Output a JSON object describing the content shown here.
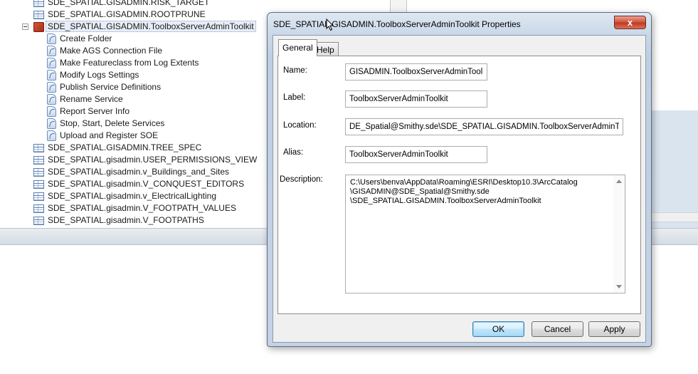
{
  "tree": {
    "items": [
      {
        "label": "SDE_SPATIAL.GISADMIN.RISK_TARGET",
        "icon": "table-icon",
        "indent": 0
      },
      {
        "label": "SDE_SPATIAL.GISADMIN.ROOTPRUNE",
        "icon": "table-icon",
        "indent": 0
      },
      {
        "label": "SDE_SPATIAL.GISADMIN.ToolboxServerAdminToolkit",
        "icon": "toolbox-icon",
        "indent": 0,
        "expanded": true,
        "selected": true
      },
      {
        "label": "Create Folder",
        "icon": "script-tool-icon",
        "indent": 1
      },
      {
        "label": "Make AGS Connection File",
        "icon": "script-tool-icon",
        "indent": 1
      },
      {
        "label": "Make Featureclass from Log Extents",
        "icon": "script-tool-icon",
        "indent": 1
      },
      {
        "label": "Modify Logs Settings",
        "icon": "script-tool-icon",
        "indent": 1
      },
      {
        "label": "Publish Service Definitions",
        "icon": "script-tool-icon",
        "indent": 1
      },
      {
        "label": "Rename Service",
        "icon": "script-tool-icon",
        "indent": 1
      },
      {
        "label": "Report Server Info",
        "icon": "script-tool-icon",
        "indent": 1
      },
      {
        "label": "Stop, Start, Delete Services",
        "icon": "script-tool-icon",
        "indent": 1
      },
      {
        "label": "Upload and Register SOE",
        "icon": "script-tool-icon",
        "indent": 1
      },
      {
        "label": "SDE_SPATIAL.GISADMIN.TREE_SPEC",
        "icon": "table-icon",
        "indent": 0
      },
      {
        "label": "SDE_SPATIAL.gisadmin.USER_PERMISSIONS_VIEW",
        "icon": "table-icon",
        "indent": 0
      },
      {
        "label": "SDE_SPATIAL.gisadmin.v_Buildings_and_Sites",
        "icon": "table-icon",
        "indent": 0
      },
      {
        "label": "SDE_SPATIAL.gisadmin.V_CONQUEST_EDITORS",
        "icon": "table-icon",
        "indent": 0
      },
      {
        "label": "SDE_SPATIAL.gisadmin.v_ElectricalLighting",
        "icon": "table-icon",
        "indent": 0
      },
      {
        "label": "SDE_SPATIAL.gisadmin.V_FOOTPATH_VALUES",
        "icon": "table-icon",
        "indent": 0
      },
      {
        "label": "SDE_SPATIAL.gisadmin.V_FOOTPATHS",
        "icon": "table-icon",
        "indent": 0
      }
    ]
  },
  "dialog": {
    "title": "SDE_SPATIAL.GISADMIN.ToolboxServerAdminToolkit Properties",
    "close_label": "x",
    "tabs": {
      "general": "General",
      "help": "Help"
    },
    "fields": {
      "name_label": "Name:",
      "name_value": "GISADMIN.ToolboxServerAdminToolkit",
      "label_label": "Label:",
      "label_value": "ToolboxServerAdminToolkit",
      "location_label": "Location:",
      "location_value": "DE_Spatial@Smithy.sde\\SDE_SPATIAL.GISADMIN.ToolboxServerAdminToolkit",
      "alias_label": "Alias:",
      "alias_value": "ToolboxServerAdminToolkit",
      "description_label": "Description:",
      "description_value": "C:\\Users\\benva\\AppData\\Roaming\\ESRI\\Desktop10.3\\ArcCatalog\n\\GISADMIN@SDE_Spatial@Smithy.sde\n\\SDE_SPATIAL.GISADMIN.ToolboxServerAdminToolkit"
    },
    "buttons": {
      "ok": "OK",
      "cancel": "Cancel",
      "apply": "Apply"
    }
  }
}
